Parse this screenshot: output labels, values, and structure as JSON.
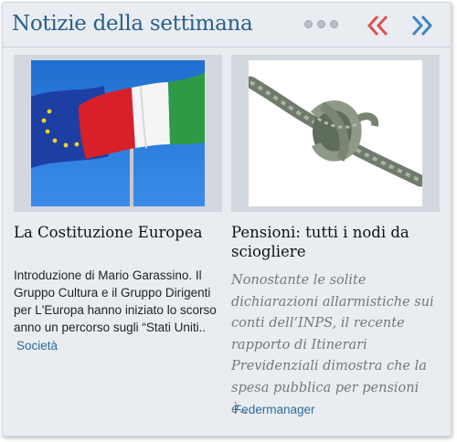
{
  "widget": {
    "title": "Notizie della settimana",
    "colors": {
      "accent": "#2a5e8c",
      "prev_arrow": "#d9534f",
      "next_arrow": "#3f86c4"
    },
    "pager": {
      "pages": 3
    },
    "prev_icon": "double-chevron-left-icon",
    "next_icon": "double-chevron-right-icon"
  },
  "articles": [
    {
      "title": "La Costituzione Europea",
      "excerpt": "Introduzione di Mario Garassino. Il Gruppo Cultura e il Gruppo Dirigenti per L'Europa hanno iniziato lo scorso anno un percorso sugli “Stati Uniti..",
      "category": "Società",
      "image": "eu-and-italian-flags"
    },
    {
      "title": "Pensioni: tutti i nodi da sciogliere",
      "excerpt": "Nonostante le solite dichiarazioni allarmistiche sui conti dell’INPS, il recente rapporto di Itinerari Previdenziali dimostra che la spesa pubblica per pensioni è..",
      "category": "Federmanager",
      "image": "knotted-rope"
    }
  ]
}
